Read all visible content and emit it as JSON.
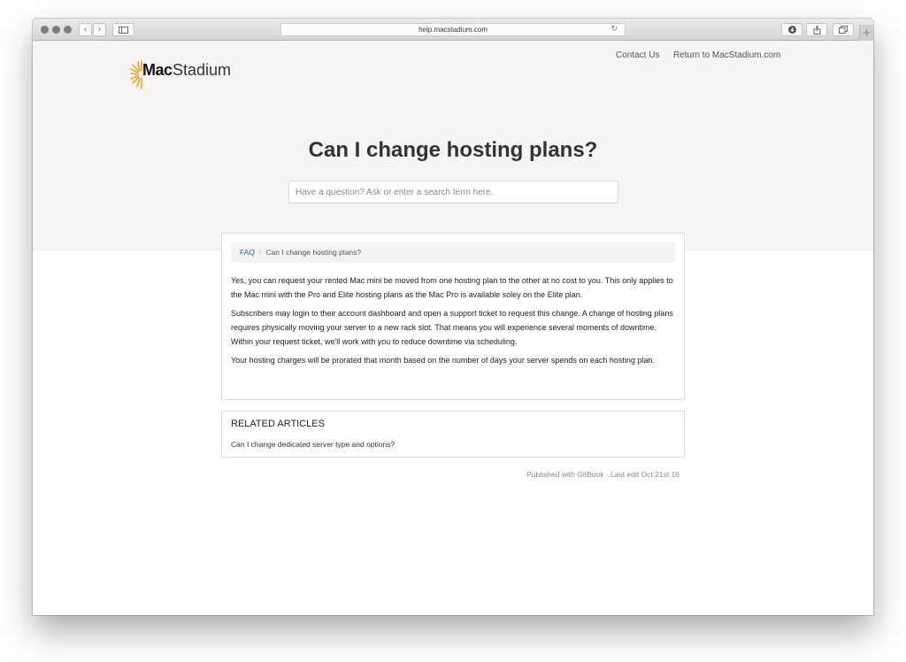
{
  "browser": {
    "url": "help.macstadium.com",
    "new_tab_glyph": "+",
    "reload_glyph": "↻",
    "back_glyph": "‹",
    "forward_glyph": "›"
  },
  "header": {
    "logo": {
      "mac": "Mac",
      "stadium": "Stadium"
    },
    "nav": {
      "contact": "Contact Us",
      "return": "Return to MacStadium.com"
    }
  },
  "hero": {
    "title": "Can I change hosting plans?",
    "search_placeholder": "Have a question? Ask or enter a search term here."
  },
  "article": {
    "breadcrumb": {
      "root": "FAQ",
      "separator": "/",
      "current": "Can I change hosting plans?"
    },
    "paragraphs": [
      "Yes, you can request your rented Mac mini be moved from one hosting plan to the other at no cost to you. This only applies to the Mac mini with the Pro and Elite hosting plans as the Mac Pro is available soley on the Elite plan.",
      "Subscribers may login to their account dashboard and open a support ticket to request this change. A change of hosting plans requires physically moving your server to a new rack slot. That means you will experience several moments of downtime. Within your request ticket, we'll work with you to reduce downtime via scheduling.",
      "Your hosting charges will be prorated that month based on the number of days your server spends on each hosting plan."
    ]
  },
  "related": {
    "title": "RELATED ARTICLES",
    "items": [
      "Can I change dedicated server type and options?"
    ]
  },
  "footer": {
    "text": "Published with GitBook · Last edit Oct 21st 16"
  },
  "colors": {
    "brand_orange": "#f6a01a",
    "link_blue": "#2a6aa6",
    "hero_bg": "#f5f5f5"
  }
}
